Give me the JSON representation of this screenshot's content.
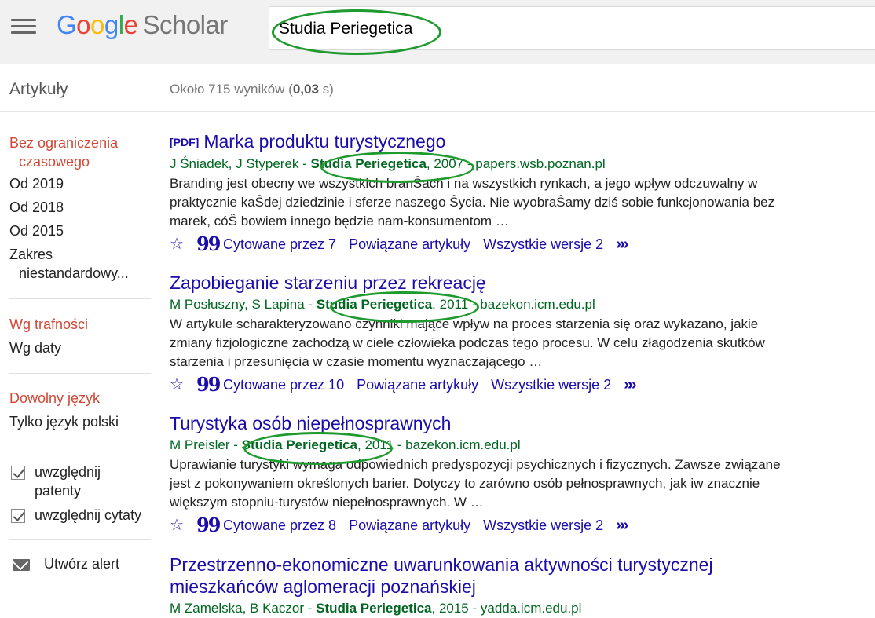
{
  "header": {
    "logo_g": "G",
    "logo_o1": "o",
    "logo_o2": "o",
    "logo_g2": "g",
    "logo_l": "l",
    "logo_e": "e",
    "logo_scholar": "Scholar",
    "search_value": "Studia Periegetica"
  },
  "subheader": {
    "section_title": "Artykuły",
    "count_prefix": "Około 715 wyników (",
    "count_time": "0,03",
    "count_suffix": " s)"
  },
  "sidebar": {
    "time": [
      "Bez ograniczenia",
      "czasowego",
      "Od 2019",
      "Od 2018",
      "Od 2015",
      "Zakres",
      "niestandardowy..."
    ],
    "sort": [
      "Wg trafności",
      "Wg daty"
    ],
    "lang": [
      "Dowolny język",
      "Tylko język polski"
    ],
    "include_patents": [
      "uwzględnij",
      "patenty"
    ],
    "include_citations": "uwzględnij cytaty",
    "alert": "Utwórz alert"
  },
  "results": [
    {
      "pdf_tag": "[PDF]",
      "title": "Marka produktu turystycznego",
      "authors": "J Śniadek, J Styperek - ",
      "journal": "Studia Periegetica",
      "source": ", 2007 - papers.wsb.poznan.pl",
      "snippet": "Branding jest obecny we wszystkich branŜach i na wszystkich rynkach, a jego wpływ odczuwalny w praktycznie kaŜdej dziedzinie i sferze naszego Ŝycia. Nie wyobraŜamy dziś sobie funkcjonowania bez marek, cóŜ bowiem innego będzie nam-konsumentom …",
      "cited": "Cytowane przez 7",
      "related": "Powiązane artykuły",
      "versions": "Wszystkie wersje 2"
    },
    {
      "title": "Zapobieganie starzeniu przez rekreację",
      "authors": "M Posłuszny, S Lapina - ",
      "journal": "Studia Periegetica",
      "source": ", 2011 - bazekon.icm.edu.pl",
      "snippet": "W artykule scharakteryzowano czynniki mające wpływ na proces starzenia się oraz wykazano, jakie zmiany fizjologiczne zachodzą w ciele człowieka podczas tego procesu. W celu złagodzenia skutków starzenia i przesunięcia w czasie momentu wyznaczającego …",
      "cited": "Cytowane przez 10",
      "related": "Powiązane artykuły",
      "versions": "Wszystkie wersje 2"
    },
    {
      "title": "Turystyka osób niepełnosprawnych",
      "authors": "M Preisler - ",
      "journal": "Studia Periegetica",
      "source": ", 2011 - bazekon.icm.edu.pl",
      "snippet": "Uprawianie turystyki wymaga odpowiednich predyspozycji psychicznych i fizycznych. Zawsze związane jest z pokonywaniem określonych barier. Dotyczy to zarówno osób pełnosprawnych, jak iw znacznie większym stopniu-turystów niepełnosprawnych. W …",
      "cited": "Cytowane przez 8",
      "related": "Powiązane artykuły",
      "versions": "Wszystkie wersje 2"
    },
    {
      "title": "Przestrzenno-ekonomiczne uwarunkowania aktywności turystycznej mieszkańców aglomeracji poznańskiej",
      "authors": "M Zamelska, B Kaczor - ",
      "journal": "Studia Periegetica",
      "source": ", 2015 - yadda.icm.edu.pl"
    }
  ],
  "colors": {
    "highlight_oval": "#1e9a2e",
    "link": "#1a0dab",
    "meta": "#006621",
    "active_filter": "#d14836"
  }
}
